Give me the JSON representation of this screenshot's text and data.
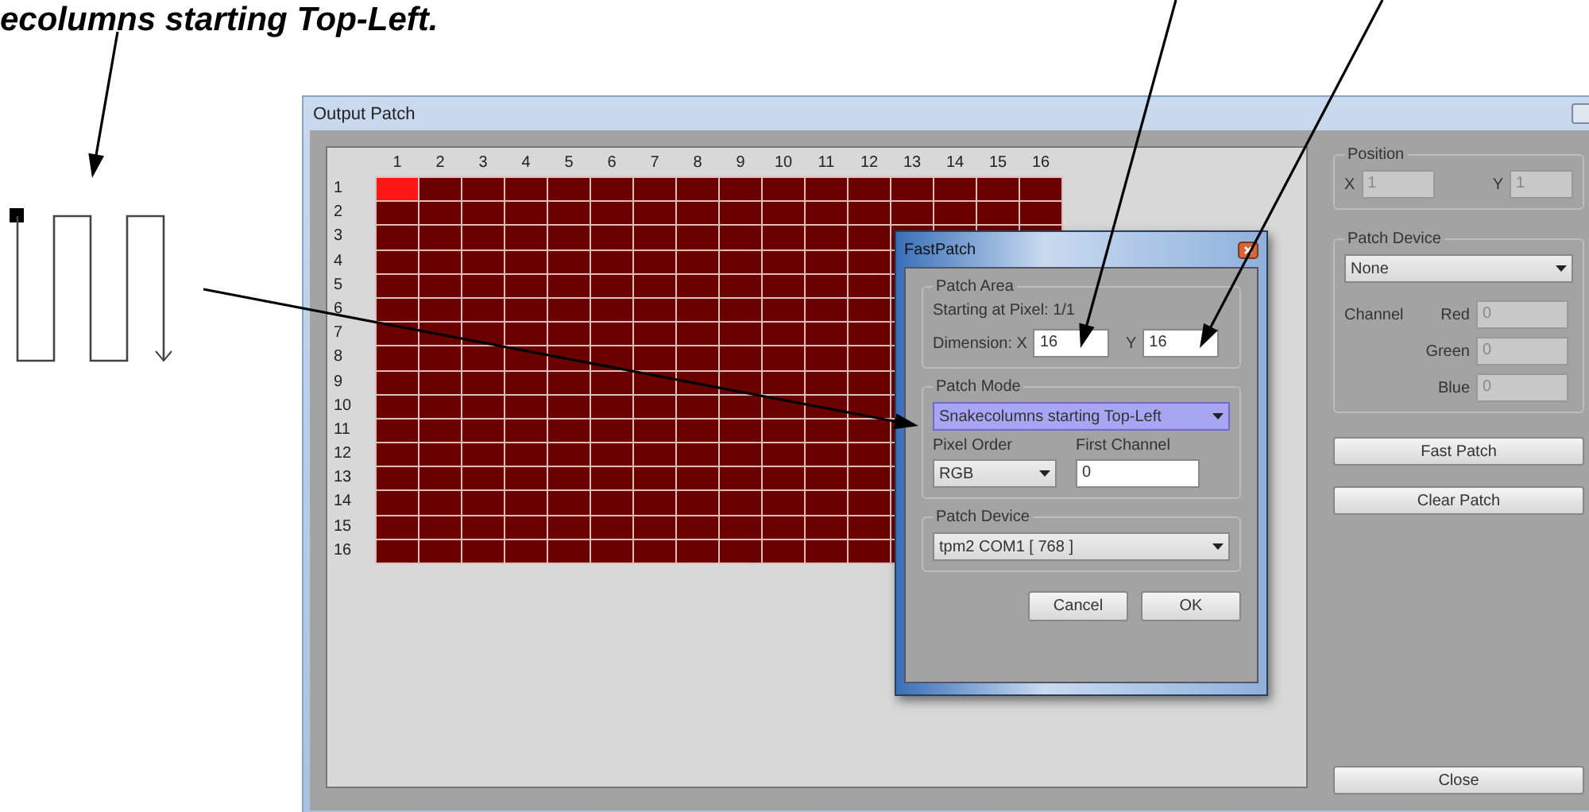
{
  "heading": "ecolumns starting Top-Left.",
  "window": {
    "title": "Output Patch"
  },
  "grid": {
    "columns": [
      "1",
      "2",
      "3",
      "4",
      "5",
      "6",
      "7",
      "8",
      "9",
      "10",
      "11",
      "12",
      "13",
      "14",
      "15",
      "16"
    ],
    "rows": [
      {
        "label": "1",
        "lit": [
          true,
          false,
          false,
          false,
          false,
          false,
          false,
          false,
          false,
          false,
          false,
          false,
          false,
          false,
          false,
          false
        ]
      },
      {
        "label": "2",
        "lit": [
          false,
          false,
          false,
          false,
          false,
          false,
          false,
          false,
          false,
          false,
          false,
          false,
          false,
          false,
          false,
          false
        ]
      },
      {
        "label": "3",
        "lit": [
          false,
          false,
          false,
          false,
          false,
          false,
          false,
          false,
          false,
          false,
          false,
          false,
          false,
          false,
          false,
          false
        ]
      },
      {
        "label": "4",
        "lit": [
          false,
          false,
          false,
          false,
          false,
          false,
          false,
          false,
          false,
          false,
          false,
          false,
          false
        ]
      },
      {
        "label": "5",
        "lit": [
          false,
          false,
          false,
          false,
          false,
          false,
          false,
          false,
          false,
          false,
          false,
          false,
          false
        ]
      },
      {
        "label": "6",
        "lit": [
          false,
          false,
          false,
          false,
          false,
          false,
          false,
          false,
          false,
          false,
          false,
          false,
          false
        ]
      },
      {
        "label": "7",
        "lit": [
          false,
          false,
          false,
          false,
          false,
          false,
          false,
          false,
          false,
          false,
          false,
          false,
          false
        ]
      },
      {
        "label": "8",
        "lit": [
          false,
          false,
          false,
          false,
          false,
          false,
          false,
          false,
          false,
          false,
          false,
          false,
          false
        ]
      },
      {
        "label": "9",
        "lit": [
          false,
          false,
          false,
          false,
          false,
          false,
          false,
          false,
          false,
          false,
          false,
          false,
          false
        ]
      },
      {
        "label": "10",
        "lit": [
          false,
          false,
          false,
          false,
          false,
          false,
          false,
          false,
          false,
          false,
          false,
          false,
          false
        ]
      },
      {
        "label": "11",
        "lit": [
          false,
          false,
          false,
          false,
          false,
          false,
          false,
          false,
          false,
          false,
          false,
          false,
          false
        ]
      },
      {
        "label": "12",
        "lit": [
          false,
          false,
          false,
          false,
          false,
          false,
          false,
          false,
          false,
          false,
          false,
          false,
          false
        ]
      },
      {
        "label": "13",
        "lit": [
          false,
          false,
          false,
          false,
          false,
          false,
          false,
          false,
          false,
          false,
          false,
          false,
          false
        ]
      },
      {
        "label": "14",
        "lit": [
          false,
          false,
          false,
          false,
          false,
          false,
          false,
          false,
          false,
          false,
          false,
          false,
          false
        ]
      },
      {
        "label": "15",
        "lit": [
          false,
          false,
          false,
          false,
          false,
          false,
          false,
          false,
          false,
          false,
          false,
          false,
          false
        ]
      },
      {
        "label": "16",
        "lit": [
          false,
          false,
          false,
          false,
          false,
          false,
          false,
          false,
          false,
          false,
          false,
          false,
          false
        ]
      }
    ]
  },
  "position": {
    "title": "Position",
    "x_label": "X",
    "x_value": "1",
    "x_disabled": true,
    "y_label": "Y",
    "y_value": "1",
    "y_disabled": true
  },
  "patch_device": {
    "title": "Patch Device",
    "device": "None",
    "channel_label": "Channel",
    "channels": [
      {
        "label": "Red",
        "value": "0",
        "disabled": true
      },
      {
        "label": "Green",
        "value": "0",
        "disabled": true
      },
      {
        "label": "Blue",
        "value": "0",
        "disabled": true
      }
    ]
  },
  "side_buttons": [
    "Fast Patch",
    "Clear Patch"
  ],
  "close_button": "Close",
  "dialog": {
    "title": "FastPatch",
    "patch_area": {
      "title": "Patch Area",
      "start": "Starting at Pixel: 1/1",
      "x_label": "Dimension: X",
      "x_value": "16",
      "y_label": "Y",
      "y_value": "16"
    },
    "patch_mode": {
      "title": "Patch Mode",
      "mode": "Snakecolumns starting Top-Left",
      "focused": true,
      "order_label": "Pixel Order",
      "order": "RGB",
      "channel_label": "First Channel",
      "channel": "0"
    },
    "patch_device": {
      "title": "Patch Device",
      "device": "tpm2 COM1 [ 768 ]"
    },
    "buttons": [
      "Cancel",
      "OK"
    ]
  }
}
